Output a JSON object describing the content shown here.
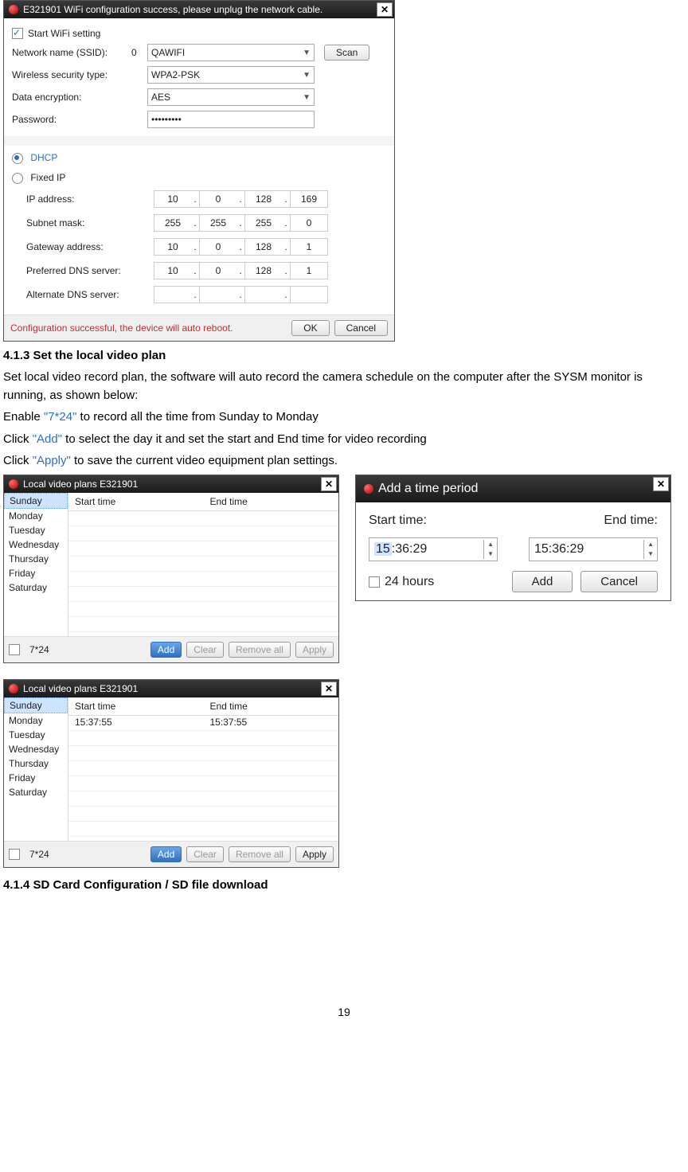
{
  "wifi": {
    "title": "E321901  WiFi configuration success, please unplug the network cable.",
    "start_label": "Start WiFi setting",
    "ssid_label": "Network name (SSID):",
    "ssid_prefix": "0",
    "ssid_value": "QAWIFI",
    "scan": "Scan",
    "sec_label": "Wireless security type:",
    "sec_value": "WPA2-PSK",
    "enc_label": "Data encryption:",
    "enc_value": "AES",
    "pwd_label": "Password:",
    "pwd_value": "•••••••••",
    "dhcp": "DHCP",
    "fixed": "Fixed IP",
    "ipaddr_l": "IP address:",
    "ipaddr": [
      "10",
      "0",
      "128",
      "169"
    ],
    "subnet_l": "Subnet mask:",
    "subnet": [
      "255",
      "255",
      "255",
      "0"
    ],
    "gw_l": "Gateway address:",
    "gw": [
      "10",
      "0",
      "128",
      "1"
    ],
    "pdns_l": "Preferred DNS server:",
    "pdns": [
      "10",
      "0",
      "128",
      "1"
    ],
    "adns_l": "Alternate DNS server:",
    "adns": [
      "",
      "",
      "",
      ""
    ],
    "foot_msg": "Configuration successful, the device will auto reboot.",
    "ok": "OK",
    "cancel": "Cancel"
  },
  "text": {
    "h1": "4.1.3 Set the local video plan",
    "p1": "Set local video record plan, the software will auto record the camera schedule on the computer after the SYSM monitor is running, as shown below:",
    "p2a": "Enable ",
    "p2q": "\"7*24\"",
    "p2b": " to record all the time from Sunday to Monday",
    "p3a": "Click ",
    "p3q": "\"Add\"",
    "p3b": " to select the day it and set the start and End time for video recording",
    "p4a": "Click ",
    "p4q": "\"Apply\"",
    "p4b": " to save the current video equipment plan settings.",
    "h2": "4.1.4 SD Card Configuration / SD file download",
    "page": "19"
  },
  "plans": {
    "title": "Local video plans E321901",
    "days": [
      "Sunday",
      "Monday",
      "Tuesday",
      "Wednesday",
      "Thursday",
      "Friday",
      "Saturday"
    ],
    "col1": "Start time",
    "col2": "End time",
    "chk": "7*24",
    "add": "Add",
    "clear": "Clear",
    "remove": "Remove all",
    "apply": "Apply",
    "row2_start": "15:37:55",
    "row2_end": "15:37:55"
  },
  "addp": {
    "title": "Add a time period",
    "start_l": "Start time:",
    "end_l": "End time:",
    "start_v_hl": "15",
    "start_v_rest": ":36:29",
    "end_v": "15:36:29",
    "chk": "24 hours",
    "add": "Add",
    "cancel": "Cancel"
  }
}
